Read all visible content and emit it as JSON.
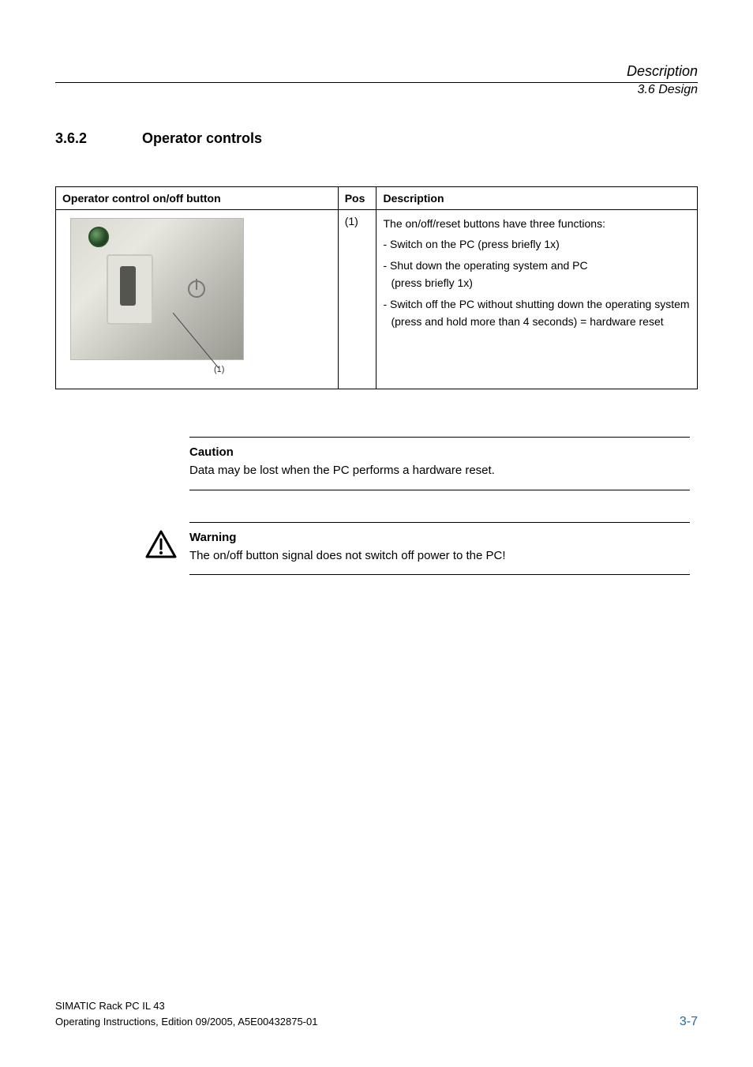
{
  "header": {
    "title": "Description",
    "subtitle": "3.6 Design"
  },
  "section": {
    "number": "3.6.2",
    "title": "Operator controls"
  },
  "table": {
    "headers": {
      "col1": "Operator control on/off button",
      "col2": "Pos",
      "col3": "Description"
    },
    "row": {
      "pos": "(1)",
      "callout": "(1)",
      "desc_intro": "The on/off/reset buttons have three functions:",
      "desc_items": [
        "- Switch on the PC (press briefly 1x)",
        "- Shut down the operating system and PC",
        "  (press briefly 1x)",
        "- Switch off the PC without shutting down the operating system",
        "  (press and hold more than 4 seconds) = hardware reset"
      ]
    }
  },
  "caution": {
    "head": "Caution",
    "text": "Data may be lost when the PC performs a hardware reset."
  },
  "warning": {
    "head": "Warning",
    "text": "The on/off button signal does not switch off power to the PC!"
  },
  "footer": {
    "line1": "SIMATIC Rack PC IL 43",
    "line2": "Operating Instructions, Edition 09/2005, A5E00432875-01",
    "page": "3-7"
  }
}
